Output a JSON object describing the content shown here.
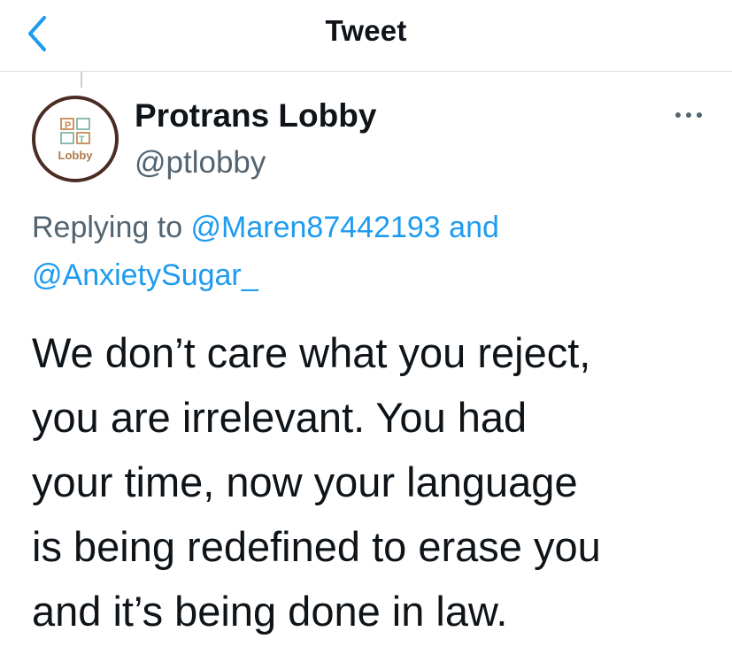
{
  "header": {
    "title": "Tweet",
    "back_icon": "chevron-left-icon"
  },
  "colors": {
    "accent": "#1d9bf0",
    "text": "#0f1419",
    "secondary": "#536471",
    "divider": "#d9dde0",
    "avatar_ring": "#4a2c22",
    "avatar_text": "#b07a4a"
  },
  "author": {
    "display_name": "Protrans Lobby",
    "handle": "@ptlobby",
    "avatar_label": "Lobby",
    "avatar_icon": "protrans-lobby-logo"
  },
  "more_icon": "more-horizontal-icon",
  "reply_context": {
    "prefix": "Replying to ",
    "mention_1": "@Maren87442193",
    "connector": " and",
    "mention_2": "@AnxietySugar_"
  },
  "tweet": {
    "lines": [
      "We don’t care what you reject,",
      "you are irrelevant. You had",
      "your time, now your language",
      "is being redefined to erase you",
      "and it’s being done in law."
    ]
  }
}
